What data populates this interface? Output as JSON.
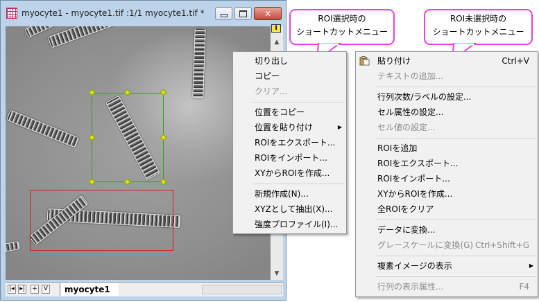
{
  "window": {
    "title": "myocyte1 - myocyte1.tif :1/1 myocyte1.tif *",
    "minimize_glyph": "▭",
    "maximize_glyph": "□",
    "close_glyph": "✕",
    "roi_tool_glyph": "I"
  },
  "tabs": {
    "nav": [
      "|◂",
      "▸|",
      "+",
      "V"
    ],
    "sheet_name": "myocyte1"
  },
  "callout_roi": {
    "line1": "ROI選択時の",
    "line2": "ショートカットメニュー"
  },
  "callout_no_roi": {
    "line1": "ROI未選択時の",
    "line2": "ショートカットメニュー"
  },
  "menu_roi": {
    "items": [
      {
        "label": "切り出し",
        "disabled": false
      },
      {
        "label": "コピー",
        "disabled": false
      },
      {
        "label": "クリア...",
        "disabled": true
      },
      {
        "label": "位置をコピー",
        "disabled": false
      },
      {
        "label": "位置を貼り付け",
        "disabled": false,
        "submenu": true
      },
      {
        "label": "ROIをエクスポート...",
        "disabled": false
      },
      {
        "label": "ROIをインポート...",
        "disabled": false
      },
      {
        "label": "XYからROIを作成...",
        "disabled": false
      },
      {
        "label": "新規作成(N)...",
        "disabled": false
      },
      {
        "label": "XYZとして抽出(X)...",
        "disabled": false
      },
      {
        "label": "強度プロファイル(I)...",
        "disabled": false
      }
    ]
  },
  "menu_no_roi": {
    "items": [
      {
        "label": "貼り付け",
        "shortcut": "Ctrl+V",
        "disabled": false,
        "icon": "paste-icon"
      },
      {
        "label": "テキストの追加...",
        "disabled": true
      },
      {
        "label": "行列次数/ラベルの設定...",
        "disabled": false
      },
      {
        "label": "セル属性の設定...",
        "disabled": false
      },
      {
        "label": "セル値の設定...",
        "disabled": true
      },
      {
        "label": "ROIを追加",
        "disabled": false
      },
      {
        "label": "ROIをエクスポート...",
        "disabled": false
      },
      {
        "label": "ROIをインポート...",
        "disabled": false
      },
      {
        "label": "XYからROIを作成...",
        "disabled": false
      },
      {
        "label": "全ROIをクリア",
        "disabled": false
      },
      {
        "label": "データに変換...",
        "disabled": false
      },
      {
        "label": "グレースケールに変換(G)",
        "shortcut": "Ctrl+Shift+G",
        "disabled": true
      },
      {
        "label": "複素イメージの表示",
        "disabled": false,
        "submenu": true
      },
      {
        "label": "行列の表示属性...",
        "shortcut": "F4",
        "disabled": true
      }
    ]
  },
  "colors": {
    "callout_border": "#ea3ee0",
    "roi_selected": "#2ea01f",
    "roi_unselected": "#d81b1b",
    "disabled_text": "#8b8b8b"
  }
}
